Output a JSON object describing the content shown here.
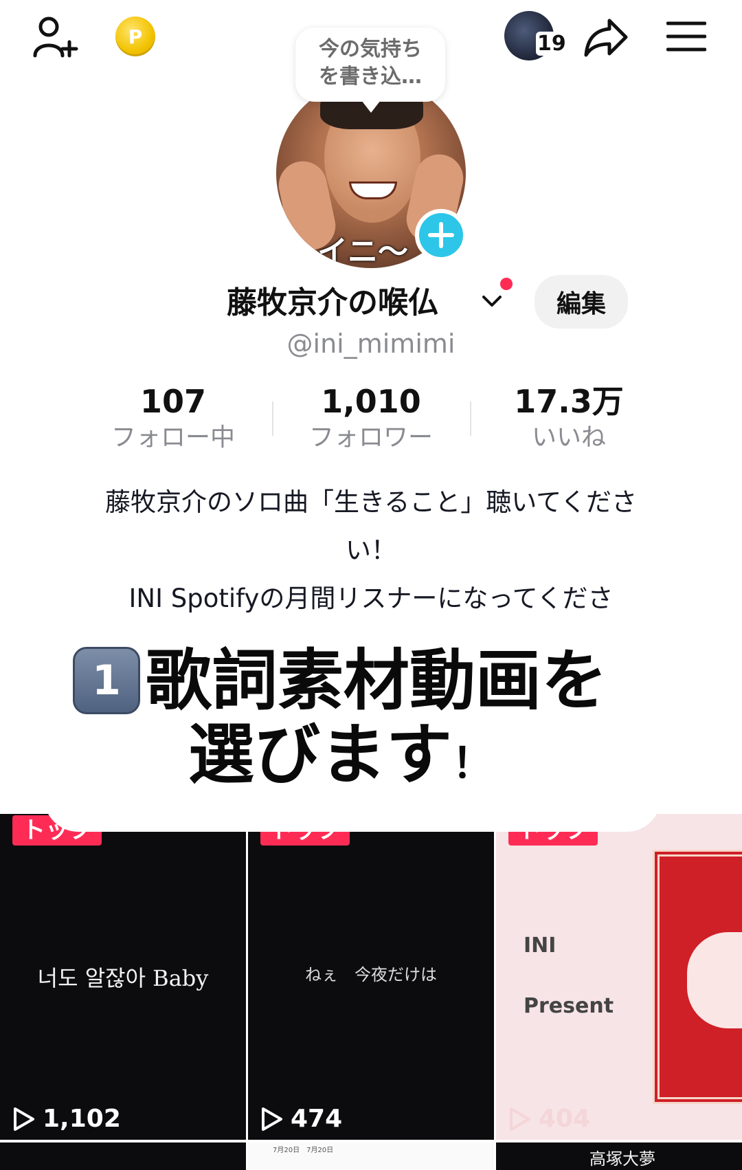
{
  "bubble": {
    "line1": "今の気持ち",
    "line2": "を書き込…"
  },
  "story": {
    "count": "19"
  },
  "coin": {
    "glyph": "P"
  },
  "avatar": {
    "caption": "イニ～"
  },
  "profile": {
    "name": "藤牧京介の喉仏",
    "edit_label": "編集",
    "handle": "@ini_mimimi"
  },
  "stats": [
    {
      "value": "107",
      "label": "フォロー中"
    },
    {
      "value": "1,010",
      "label": "フォロワー"
    },
    {
      "value": "17.3万",
      "label": "いいね"
    }
  ],
  "bio": {
    "line1": "藤牧京介のソロ曲「生きること」聴いてくださ",
    "line2": "い！",
    "line3": "INI Spotifyの月間リスナーになってくださ"
  },
  "overlay": {
    "keycap": "1",
    "line1": "歌詞素材動画を",
    "line2": "選びます",
    "line2_end": "！"
  },
  "videos": [
    {
      "badge": "トップ",
      "text": "너도 알잖아 Baby",
      "views": "1,102"
    },
    {
      "badge": "トップ",
      "text": "ねぇ　今夜だけは",
      "views": "474"
    },
    {
      "badge": "トップ",
      "text_line1": "INI",
      "text_line2": "Present",
      "views": "404"
    }
  ],
  "row2": {
    "tile2_text_1": "7月20日　7月20日",
    "tile3_text": "高塚大夢"
  },
  "colors": {
    "accent": "#fe2c55",
    "avatar_add": "#2dc6e8",
    "secondary_text": "#8a8b91"
  },
  "icons": [
    "add-user-icon",
    "coin-icon",
    "share-icon",
    "menu-icon",
    "plus-icon",
    "chevron-down-icon",
    "play-icon"
  ]
}
